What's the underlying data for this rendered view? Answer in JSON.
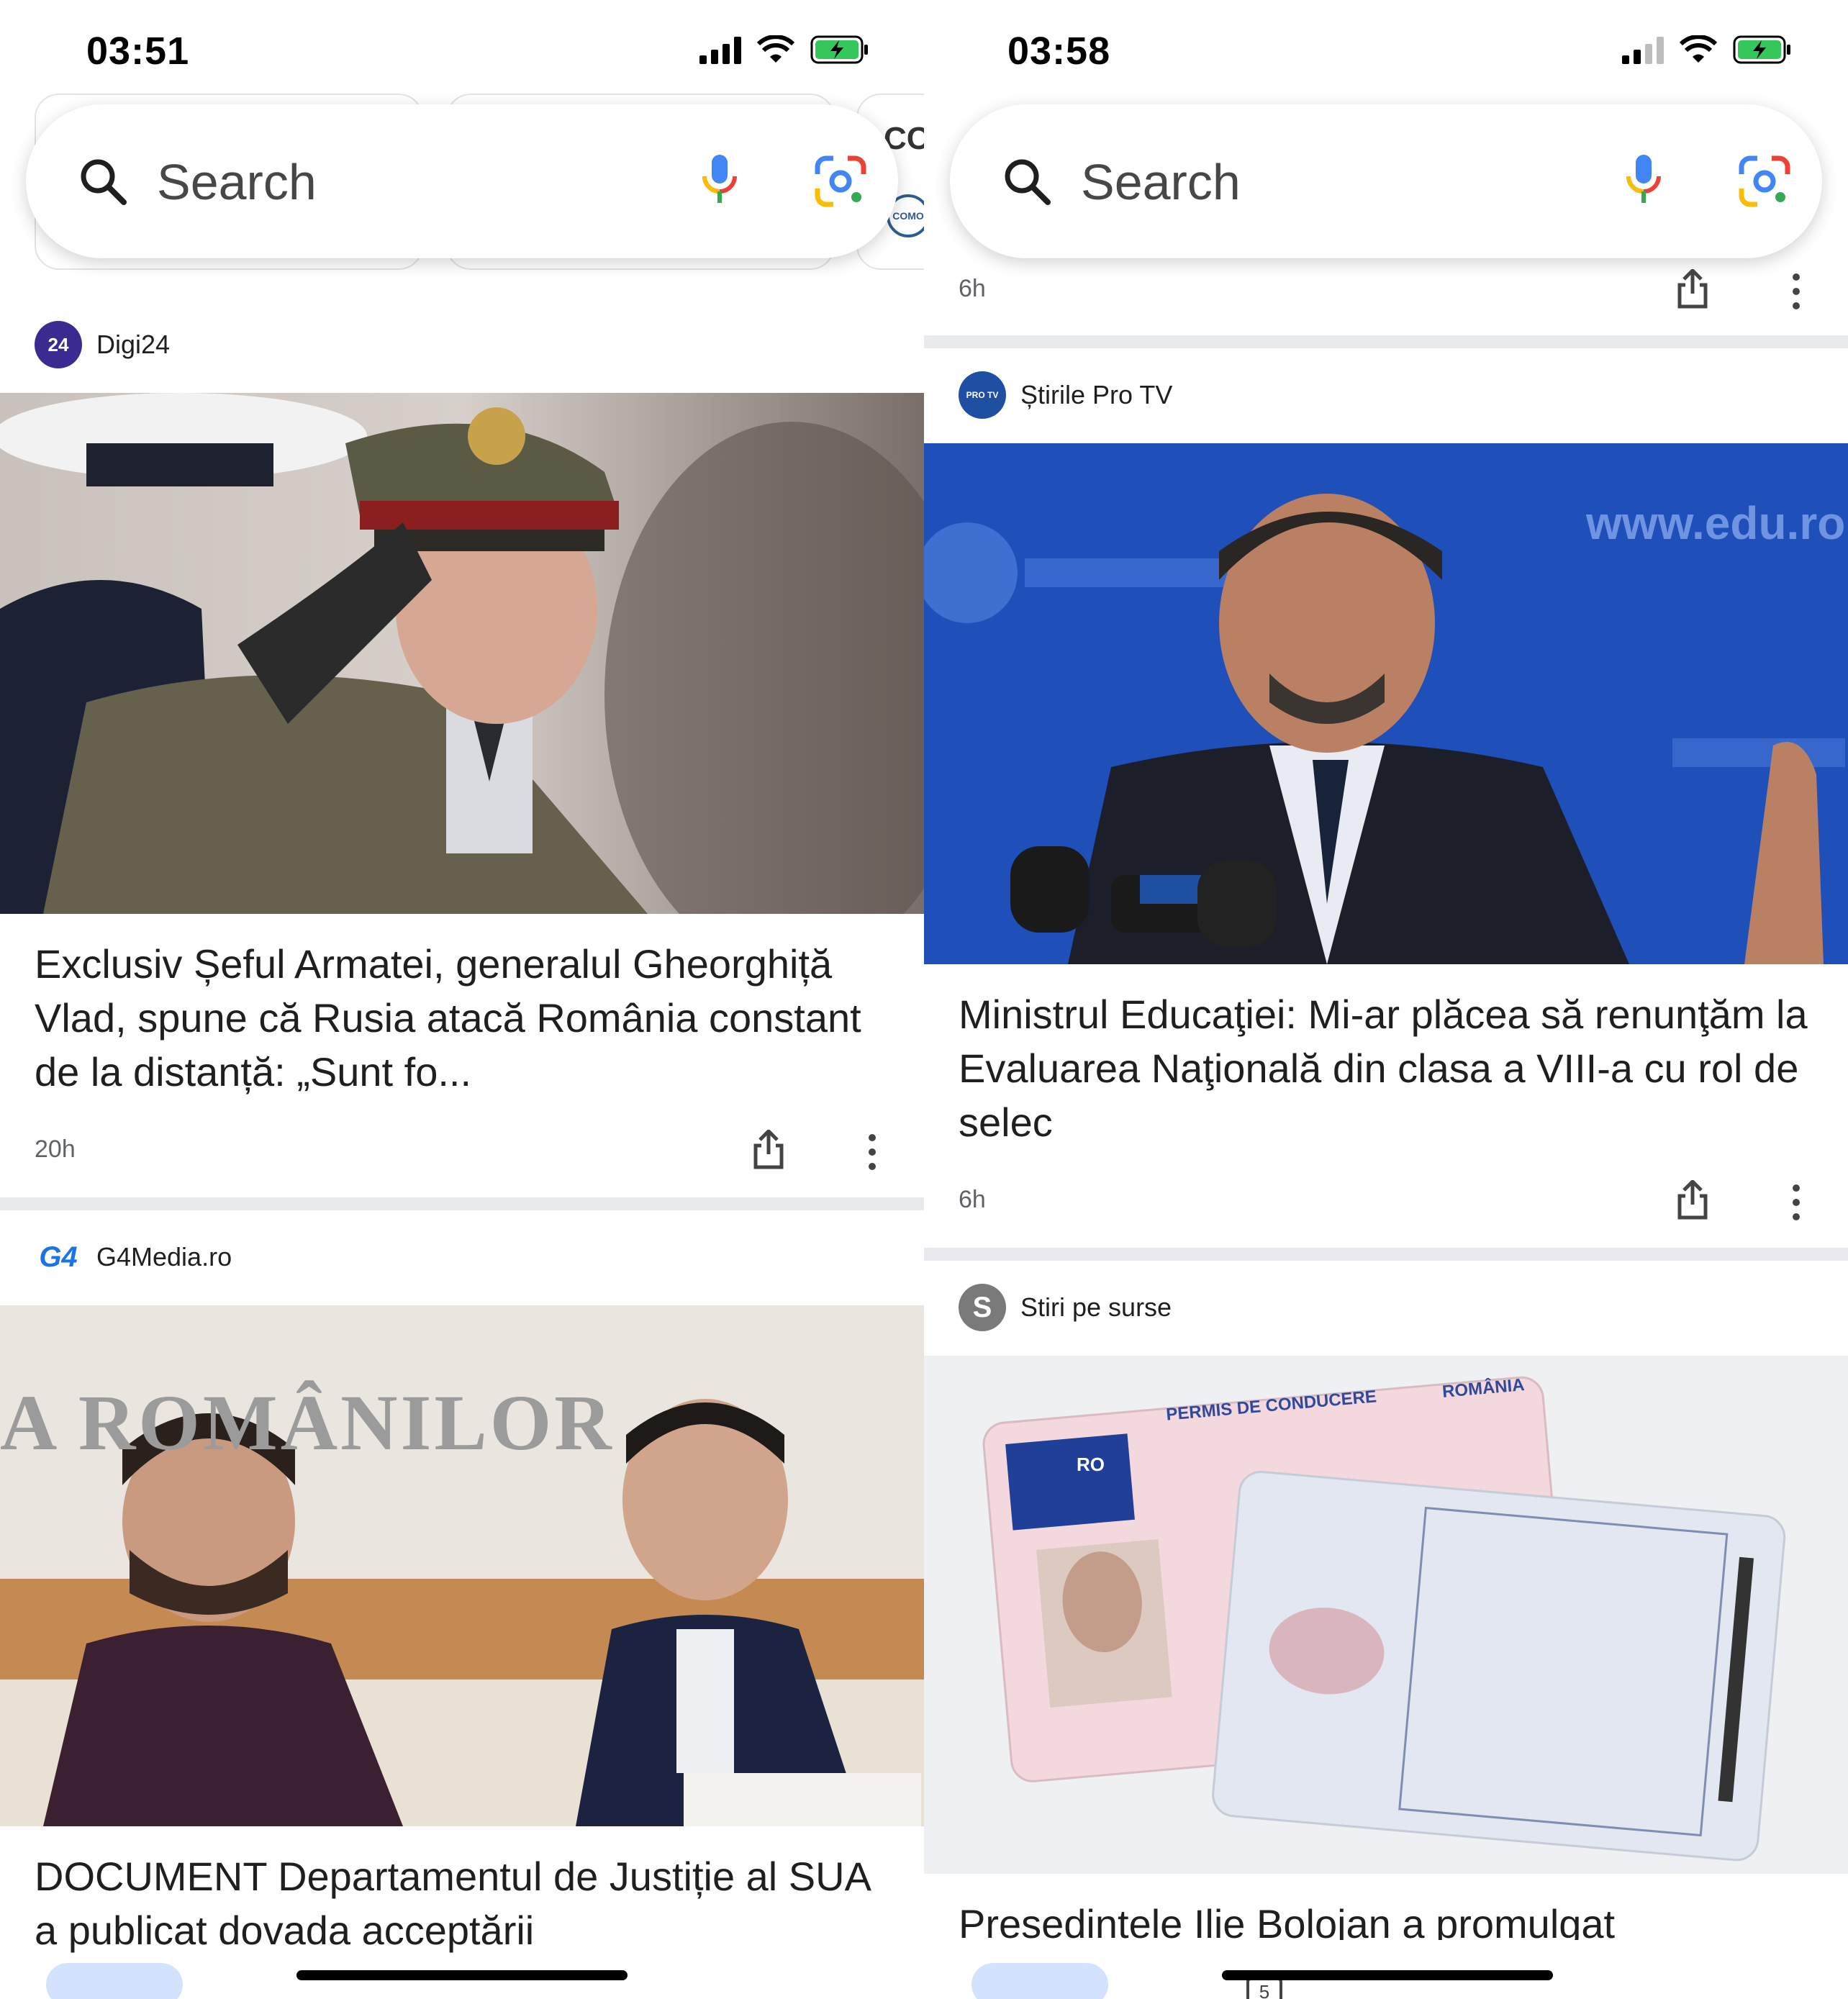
{
  "left": {
    "status": {
      "time": "03:51"
    },
    "search": {
      "placeholder": "Search"
    },
    "peek": {
      "text": "CC",
      "logo": "COMO"
    },
    "card1": {
      "source": "Digi24",
      "source_logo": "24",
      "headline": "Exclusiv Șeful Armatei, generalul Gheorghiță Vlad, spune că Rusia atacă România constant de la distanță: „Sunt fo...",
      "age": "20h"
    },
    "card2": {
      "source": "G4Media.ro",
      "source_logo": "G4",
      "headline": "DOCUMENT Departamentul de Justiție al SUA a publicat dovada acceptării",
      "photo_text": "A ROMÂNILOR"
    }
  },
  "right": {
    "status": {
      "time": "03:58"
    },
    "search": {
      "placeholder": "Search"
    },
    "prev": {
      "age": "6h"
    },
    "card1": {
      "source": "Știrile Pro TV",
      "source_logo": "PRO TV",
      "headline": "Ministrul Educaţiei: Mi-ar plăcea să renunţăm la Evaluarea Naţională din clasa a VIII-a cu rol de selec",
      "age": "6h",
      "photo_text": "www.edu.ro"
    },
    "card2": {
      "source": "Stiri pe surse",
      "source_logo": "S",
      "headline": "Presedintele Ilie Bolojan a promulgat",
      "photo_title": "PERMIS DE CONDUCERE",
      "photo_country": "ROMÂNIA",
      "photo_flag": "RO"
    },
    "nav": {
      "tabs_count": "5"
    }
  },
  "colors": {
    "accent_blue": "#1a73e8",
    "divider": "#e8eaed",
    "battery_green": "#34c759"
  }
}
